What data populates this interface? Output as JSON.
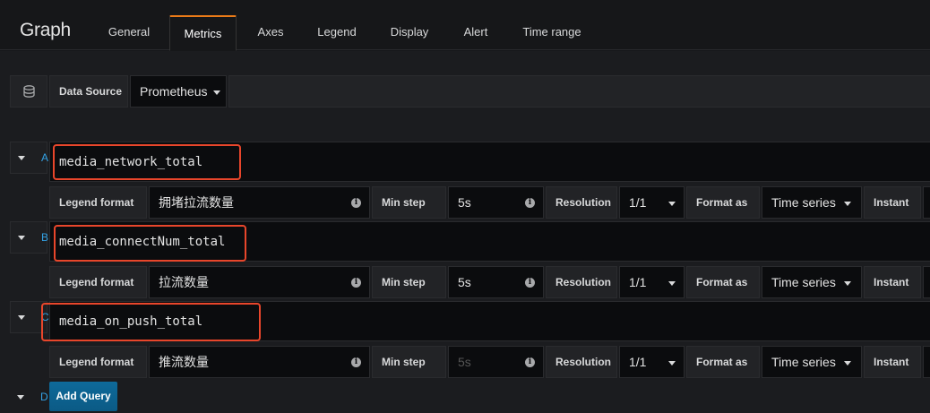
{
  "panel": {
    "title": "Graph"
  },
  "tabs": [
    {
      "label": "General"
    },
    {
      "label": "Metrics"
    },
    {
      "label": "Axes"
    },
    {
      "label": "Legend"
    },
    {
      "label": "Display"
    },
    {
      "label": "Alert"
    },
    {
      "label": "Time range"
    }
  ],
  "active_tab": "Metrics",
  "datasource": {
    "label": "Data Source",
    "value": "Prometheus",
    "icon": "database-icon"
  },
  "queries": [
    {
      "letter": "A",
      "expression": "media_network_total",
      "legend_label": "Legend format",
      "legend_value": "拥堵拉流数量",
      "min_step_label": "Min step",
      "min_step_value": "5s",
      "resolution_label": "Resolution",
      "resolution_value": "1/1",
      "format_label": "Format as",
      "format_value": "Time series",
      "instant_label": "Instant"
    },
    {
      "letter": "B",
      "expression": "media_connectNum_total",
      "legend_label": "Legend format",
      "legend_value": "拉流数量",
      "min_step_label": "Min step",
      "min_step_value": "5s",
      "resolution_label": "Resolution",
      "resolution_value": "1/1",
      "format_label": "Format as",
      "format_value": "Time series",
      "instant_label": "Instant"
    },
    {
      "letter": "C",
      "expression": "media_on_push_total",
      "legend_label": "Legend format",
      "legend_value": "推流数量",
      "min_step_label": "Min step",
      "min_step_placeholder": "5s",
      "resolution_label": "Resolution",
      "resolution_value": "1/1",
      "format_label": "Format as",
      "format_value": "Time series",
      "instant_label": "Instant"
    }
  ],
  "next_query": {
    "letter": "D",
    "add_label": "Add Query"
  },
  "colors": {
    "accent": "#eb7b18",
    "highlight": "#e8462b",
    "query_letter": "#33a2e5",
    "primary_button": "#0b5a85"
  }
}
